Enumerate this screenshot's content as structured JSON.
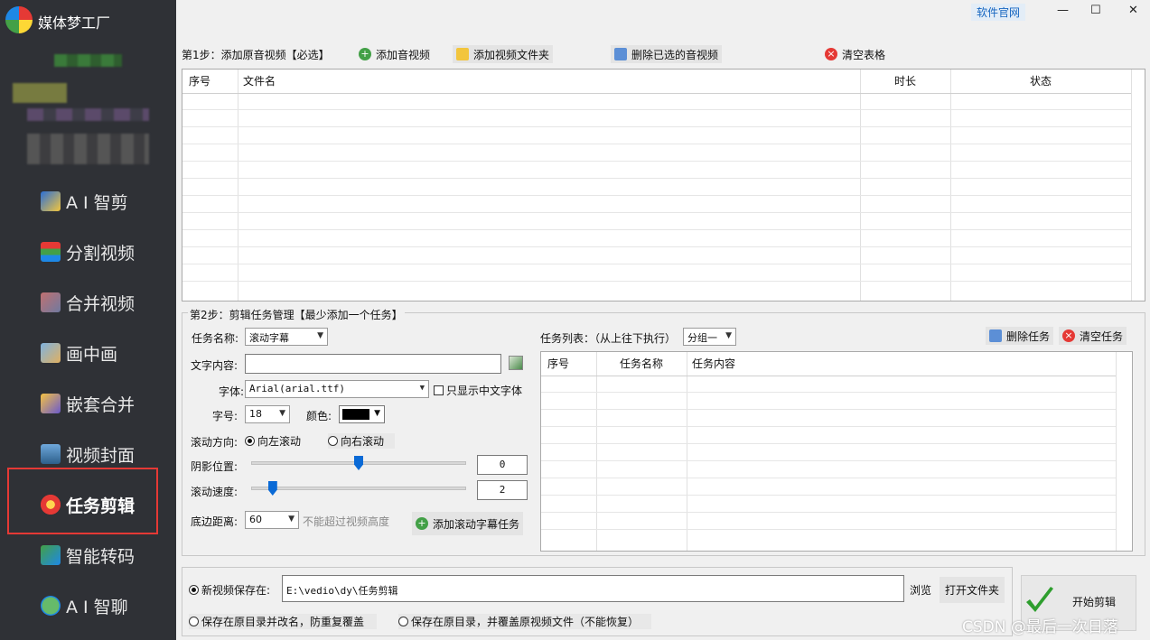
{
  "app": {
    "title": "媒体梦工厂",
    "official_site": "软件官网",
    "minimize": "—",
    "maximize": "☐",
    "close": "✕"
  },
  "sidebar": {
    "items": [
      {
        "label": "A I 智剪",
        "icon": "ai-cut-icon"
      },
      {
        "label": "分割视频",
        "icon": "split-icon"
      },
      {
        "label": "合并视频",
        "icon": "merge-icon"
      },
      {
        "label": "画中画",
        "icon": "pip-icon"
      },
      {
        "label": "嵌套合并",
        "icon": "nest-icon"
      },
      {
        "label": "视频封面",
        "icon": "cover-icon"
      },
      {
        "label": "任务剪辑",
        "icon": "flower-icon"
      },
      {
        "label": "智能转码",
        "icon": "transcode-icon"
      },
      {
        "label": "A I 智聊",
        "icon": "chat-icon"
      }
    ],
    "active_index": 6
  },
  "step1": {
    "label": "第1步：添加原音视频【必选】",
    "add_audio": "添加音视频",
    "add_folder": "添加视频文件夹",
    "delete_selected": "删除已选的音视频",
    "clear_table": "清空表格",
    "columns": [
      "序号",
      "文件名",
      "时长",
      "状态"
    ]
  },
  "step2": {
    "label": "第2步：剪辑任务管理【最少添加一个任务】",
    "task_name_label": "任务名称:",
    "task_name_value": "滚动字幕",
    "text_label": "文字内容:",
    "text_value": "",
    "font_label": "字体:",
    "font_value": "Arial(arial.ttf)",
    "only_chinese": "只显示中文字体",
    "size_label": "字号:",
    "size_value": "18",
    "color_label": "颜色:",
    "direction_label": "滚动方向:",
    "dir_left": "向左滚动",
    "dir_right": "向右滚动",
    "shadow_label": "阴影位置:",
    "shadow_value": "0",
    "shadow_level": 0.5,
    "speed_label": "滚动速度:",
    "speed_value": "2",
    "speed_level": 0.1,
    "bottom_label": "底边距离:",
    "bottom_value": "60",
    "bottom_hint": "不能超过视频高度",
    "add_task": "添加滚动字幕任务",
    "task_list_label": "任务列表：（从上往下执行）",
    "group_value": "分组一",
    "delete_task": "删除任务",
    "clear_task": "清空任务",
    "task_columns": [
      "序号",
      "任务名称",
      "任务内容"
    ]
  },
  "output": {
    "save_new_label": "新视频保存在:",
    "save_path": "E:\\vedio\\dy\\任务剪辑",
    "browse": "浏览",
    "open_folder": "打开文件夹",
    "opt_rename": "保存在原目录并改名，防重复覆盖",
    "opt_overwrite": "保存在原目录，并覆盖原视频文件（不能恢复）",
    "start": "开始剪辑"
  },
  "watermark": "CSDN @最后一次日落"
}
